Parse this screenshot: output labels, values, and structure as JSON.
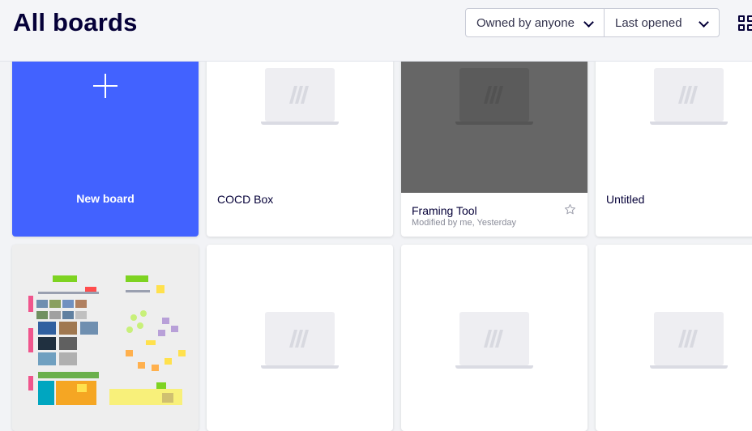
{
  "header": {
    "title": "All boards",
    "owner_filter": "Owned by anyone",
    "sort_filter": "Last opened",
    "view_icon": "grid-view-icon"
  },
  "boards": [
    {
      "title": "New board",
      "type": "new",
      "icon": "plus-icon",
      "accent": "#4262ff"
    },
    {
      "title": "COCD Box",
      "meta": "",
      "thumbnail": "placeholder"
    },
    {
      "title": "Framing Tool",
      "meta": "Modified by me, Yesterday",
      "thumbnail": "placeholder-hover",
      "starred": false,
      "icon": "star-icon"
    },
    {
      "title": "Untitled",
      "meta": "",
      "thumbnail": "placeholder"
    },
    {
      "title": "",
      "thumbnail": "board-preview"
    },
    {
      "title": "",
      "thumbnail": "placeholder"
    },
    {
      "title": "",
      "thumbnail": "placeholder"
    },
    {
      "title": "",
      "thumbnail": "placeholder"
    }
  ],
  "colors": {
    "brand_blue": "#4262ff",
    "text_dark": "#050038",
    "hover_overlay": "#666666"
  }
}
